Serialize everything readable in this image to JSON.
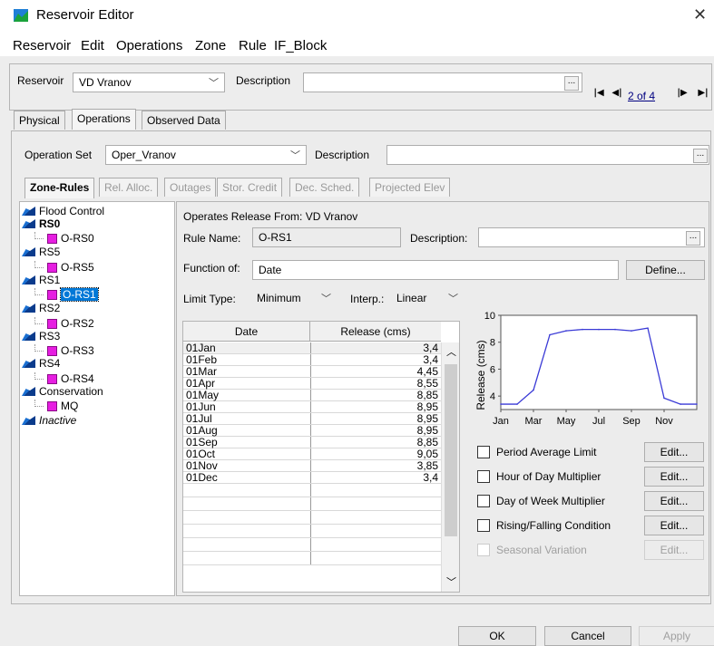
{
  "window": {
    "title": "Reservoir Editor",
    "close_glyph": "✕"
  },
  "menu": [
    "Reservoir",
    "Edit",
    "Operations",
    "Zone",
    "Rule",
    "IF_Block"
  ],
  "reservoir_bar": {
    "reservoir_label": "Reservoir",
    "reservoir_value": "VD Vranov",
    "description_label": "Description",
    "description_value": "",
    "nav_first": "|◀",
    "nav_prev": "◀|",
    "position": "2 of 4",
    "nav_next": "|▶",
    "nav_last": "▶|"
  },
  "tabs": [
    "Physical",
    "Operations",
    "Observed Data"
  ],
  "opset": {
    "label": "Operation Set",
    "value": "Oper_Vranov",
    "description_label": "Description",
    "description_value": ""
  },
  "subtabs": [
    "Zone-Rules",
    "Rel. Alloc.",
    "Outages",
    "Stor. Credit",
    "Dec. Sched.",
    "Projected Elev"
  ],
  "tree": [
    {
      "type": "zone",
      "label": "Flood Control"
    },
    {
      "type": "zone",
      "label": "RS0"
    },
    {
      "type": "rule",
      "label": "O-RS0"
    },
    {
      "type": "zone",
      "label": "RS5"
    },
    {
      "type": "rule",
      "label": "O-RS5"
    },
    {
      "type": "zone",
      "label": "RS1"
    },
    {
      "type": "rule",
      "label": "O-RS1"
    },
    {
      "type": "zone",
      "label": "RS2"
    },
    {
      "type": "rule",
      "label": "O-RS2"
    },
    {
      "type": "zone",
      "label": "RS3"
    },
    {
      "type": "rule",
      "label": "O-RS3"
    },
    {
      "type": "zone",
      "label": "RS4"
    },
    {
      "type": "rule",
      "label": "O-RS4"
    },
    {
      "type": "zone",
      "label": "Conservation"
    },
    {
      "type": "rule",
      "label": "MQ"
    },
    {
      "type": "zone",
      "label": "Inactive"
    }
  ],
  "rule": {
    "operates_from": "Operates Release From: VD Vranov",
    "rule_name_label": "Rule Name:",
    "rule_name_value": "O-RS1",
    "description_label": "Description:",
    "description_value": "",
    "function_of_label": "Function of:",
    "function_of_value": "Date",
    "define_button": "Define...",
    "limit_type_label": "Limit Type:",
    "limit_type_value": "Minimum",
    "interp_label": "Interp.:",
    "interp_value": "Linear"
  },
  "table": {
    "headers": [
      "Date",
      "Release (cms)"
    ],
    "rows": [
      [
        "01Jan",
        "3,4"
      ],
      [
        "01Feb",
        "3,4"
      ],
      [
        "01Mar",
        "4,45"
      ],
      [
        "01Apr",
        "8,55"
      ],
      [
        "01May",
        "8,85"
      ],
      [
        "01Jun",
        "8,95"
      ],
      [
        "01Jul",
        "8,95"
      ],
      [
        "01Aug",
        "8,95"
      ],
      [
        "01Sep",
        "8,85"
      ],
      [
        "01Oct",
        "9,05"
      ],
      [
        "01Nov",
        "3,85"
      ],
      [
        "01Dec",
        "3,4"
      ]
    ]
  },
  "chart_data": {
    "type": "line",
    "x": [
      "01Jan",
      "01Feb",
      "01Mar",
      "01Apr",
      "01May",
      "01Jun",
      "01Jul",
      "01Aug",
      "01Sep",
      "01Oct",
      "01Nov",
      "01Dec",
      "31Dec"
    ],
    "values": [
      3.4,
      3.4,
      4.45,
      8.55,
      8.85,
      8.95,
      8.95,
      8.95,
      8.85,
      9.05,
      3.85,
      3.4,
      3.4
    ],
    "ylabel": "Release (cms)",
    "xlabel": "",
    "title": "",
    "xticks": [
      "Jan",
      "Mar",
      "May",
      "Jul",
      "Sep",
      "Nov"
    ],
    "yticks": [
      "4",
      "6",
      "8",
      "10"
    ],
    "ylim": [
      3,
      10
    ],
    "grid": false,
    "color": "#3b3bd6"
  },
  "options": [
    {
      "label": "Period Average Limit",
      "edit": "Edit...",
      "enabled": true
    },
    {
      "label": "Hour of Day Multiplier",
      "edit": "Edit...",
      "enabled": true
    },
    {
      "label": "Day of Week Multiplier",
      "edit": "Edit...",
      "enabled": true
    },
    {
      "label": "Rising/Falling Condition",
      "edit": "Edit...",
      "enabled": true
    },
    {
      "label": "Seasonal Variation",
      "edit": "Edit...",
      "enabled": false
    }
  ],
  "footer": {
    "ok": "OK",
    "cancel": "Cancel",
    "apply": "Apply"
  }
}
